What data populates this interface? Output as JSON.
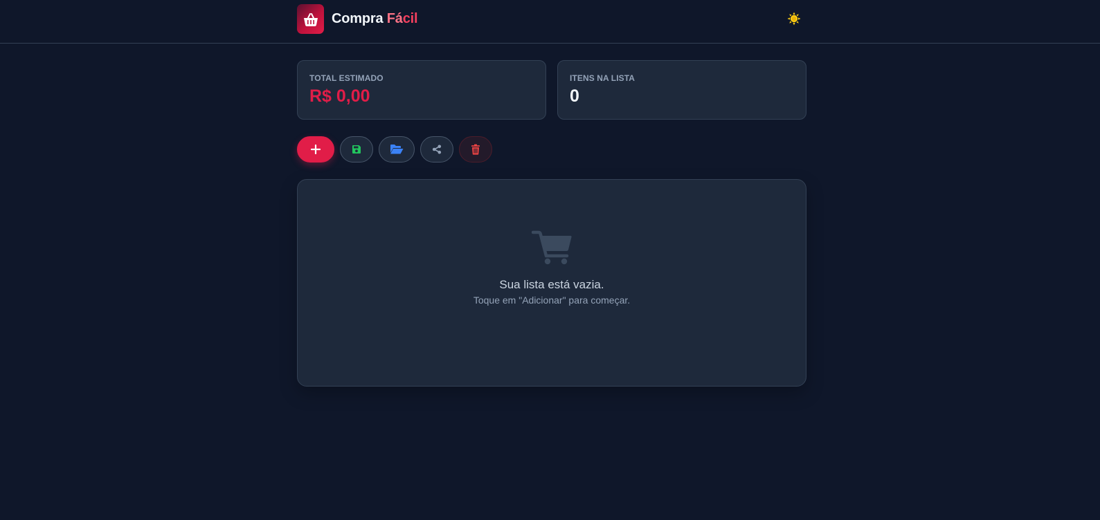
{
  "app": {
    "brand_part1": "Compra ",
    "brand_part2": "Fá",
    "brand_part3": "cil",
    "logo_icon": "basket-icon",
    "theme_toggle_icon": "sun-icon"
  },
  "summary": {
    "total_label": "TOTAL ESTIMADO",
    "total_value": "R$ 0,00",
    "items_label": "ITENS NA LISTA",
    "items_value": "0"
  },
  "toolbar": {
    "add_icon": "plus-icon",
    "save_icon": "floppy-disk-icon",
    "open_icon": "folder-open-icon",
    "share_icon": "share-icon",
    "clear_icon": "trash-icon"
  },
  "empty_state": {
    "icon": "shopping-cart-icon",
    "title": "Sua lista está vazia.",
    "subtitle": "Toque em \"Adicionar\" para começar."
  },
  "colors": {
    "background": "#0f172a",
    "card": "#1e293b",
    "accent": "#e11d48",
    "save_green": "#22c55e",
    "open_blue": "#3b82f6",
    "clear_red": "#ef4444",
    "sun_yellow": "#facc15"
  }
}
